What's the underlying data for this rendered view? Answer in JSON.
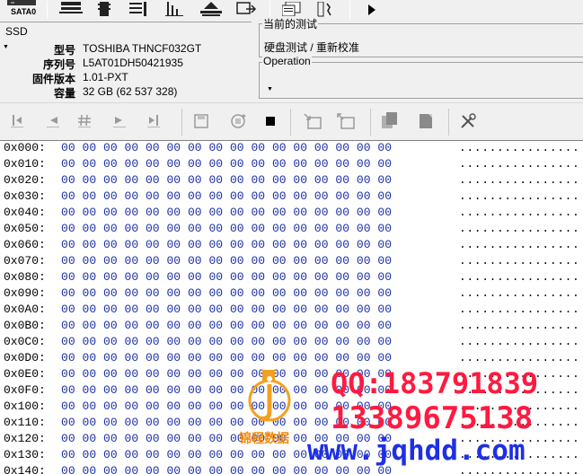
{
  "top_toolbar": {
    "sata_label": "SATA0"
  },
  "ssd_panel": {
    "title": "SSD",
    "rows": [
      {
        "label": "型号",
        "value": "TOSHIBA THNCF032GT"
      },
      {
        "label": "序列号",
        "value": "L5AT01DH50421935"
      },
      {
        "label": "固件版本",
        "value": "1.01-PXT"
      },
      {
        "label": "容量",
        "value": "32 GB (62 537 328)"
      }
    ]
  },
  "current_test": {
    "legend": "当前的测试",
    "value": "硬盘测试 / 重新校准"
  },
  "operation": {
    "legend": "Operation"
  },
  "hex_view": {
    "rows": [
      {
        "addr": "0x000:",
        "bytes": "00 00 00 00 00 00 00 00 00 00 00 00 00 00 00 00",
        "ascii": "................"
      },
      {
        "addr": "0x010:",
        "bytes": "00 00 00 00 00 00 00 00 00 00 00 00 00 00 00 00",
        "ascii": "................"
      },
      {
        "addr": "0x020:",
        "bytes": "00 00 00 00 00 00 00 00 00 00 00 00 00 00 00 00",
        "ascii": "................"
      },
      {
        "addr": "0x030:",
        "bytes": "00 00 00 00 00 00 00 00 00 00 00 00 00 00 00 00",
        "ascii": "................"
      },
      {
        "addr": "0x040:",
        "bytes": "00 00 00 00 00 00 00 00 00 00 00 00 00 00 00 00",
        "ascii": "................"
      },
      {
        "addr": "0x050:",
        "bytes": "00 00 00 00 00 00 00 00 00 00 00 00 00 00 00 00",
        "ascii": "................"
      },
      {
        "addr": "0x060:",
        "bytes": "00 00 00 00 00 00 00 00 00 00 00 00 00 00 00 00",
        "ascii": "................"
      },
      {
        "addr": "0x070:",
        "bytes": "00 00 00 00 00 00 00 00 00 00 00 00 00 00 00 00",
        "ascii": "................"
      },
      {
        "addr": "0x080:",
        "bytes": "00 00 00 00 00 00 00 00 00 00 00 00 00 00 00 00",
        "ascii": "................"
      },
      {
        "addr": "0x090:",
        "bytes": "00 00 00 00 00 00 00 00 00 00 00 00 00 00 00 00",
        "ascii": "................"
      },
      {
        "addr": "0x0A0:",
        "bytes": "00 00 00 00 00 00 00 00 00 00 00 00 00 00 00 00",
        "ascii": "................"
      },
      {
        "addr": "0x0B0:",
        "bytes": "00 00 00 00 00 00 00 00 00 00 00 00 00 00 00 00",
        "ascii": "................"
      },
      {
        "addr": "0x0C0:",
        "bytes": "00 00 00 00 00 00 00 00 00 00 00 00 00 00 00 00",
        "ascii": "................"
      },
      {
        "addr": "0x0D0:",
        "bytes": "00 00 00 00 00 00 00 00 00 00 00 00 00 00 00 00",
        "ascii": "................"
      },
      {
        "addr": "0x0E0:",
        "bytes": "00 00 00 00 00 00 00 00 00 00 00 00 00 00 00 00",
        "ascii": "................"
      },
      {
        "addr": "0x0F0:",
        "bytes": "00 00 00 00 00 00 00 00 00 00 00 00 00 00 00 00",
        "ascii": "................"
      },
      {
        "addr": "0x100:",
        "bytes": "00 00 00 00 00 00 00 00 00 00 00 00 00 00 00 00",
        "ascii": "................"
      },
      {
        "addr": "0x110:",
        "bytes": "00 00 00 00 00 00 00 00 00 00 00 00 00 00 00 00",
        "ascii": "................"
      },
      {
        "addr": "0x120:",
        "bytes": "00 00 00 00 00 00 00 00 00 00 00 00 00 00 00 00",
        "ascii": "................"
      },
      {
        "addr": "0x130:",
        "bytes": "00 00 00 00 00 00 00 00 00 00 00 00 00 00 00 00",
        "ascii": "................"
      },
      {
        "addr": "0x140:",
        "bytes": "00 00 00 00 00 00 00 00 00 00 00 00 00 00 00 00",
        "ascii": "................"
      }
    ]
  },
  "watermark": {
    "qq": "QQ:183791839",
    "phone": "13389675138",
    "url": "www.jqhdd.com",
    "logo_text": "锦程数据"
  }
}
